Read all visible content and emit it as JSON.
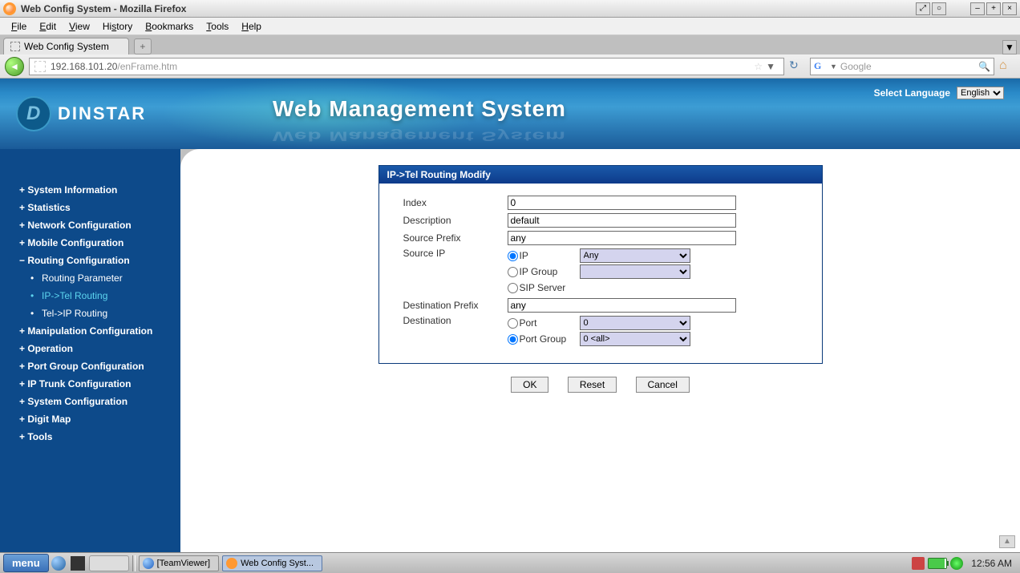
{
  "window": {
    "title": "Web Config System - Mozilla Firefox",
    "btn_min": "–",
    "btn_max": "+",
    "btn_close": "×"
  },
  "menubar": [
    "File",
    "Edit",
    "View",
    "History",
    "Bookmarks",
    "Tools",
    "Help"
  ],
  "tab": {
    "title": "Web Config System"
  },
  "url": {
    "host": "192.168.101.20",
    "path": "/enFrame.htm"
  },
  "search": {
    "placeholder": "Google"
  },
  "banner": {
    "brand": "DINSTAR",
    "title": "Web Management System",
    "lang_label": "Select Language",
    "lang_value": "English"
  },
  "sidebar": {
    "items": [
      {
        "label": "System Information",
        "type": "top"
      },
      {
        "label": "Statistics",
        "type": "top"
      },
      {
        "label": "Network Configuration",
        "type": "top"
      },
      {
        "label": "Mobile Configuration",
        "type": "top"
      },
      {
        "label": "Routing Configuration",
        "type": "top-expanded"
      },
      {
        "label": "Routing Parameter",
        "type": "sub"
      },
      {
        "label": "IP->Tel Routing",
        "type": "sub-active"
      },
      {
        "label": "Tel->IP Routing",
        "type": "sub"
      },
      {
        "label": "Manipulation Configuration",
        "type": "top"
      },
      {
        "label": "Operation",
        "type": "top"
      },
      {
        "label": "Port Group Configuration",
        "type": "top"
      },
      {
        "label": "IP Trunk Configuration",
        "type": "top"
      },
      {
        "label": "System Configuration",
        "type": "top"
      },
      {
        "label": "Digit Map",
        "type": "top"
      },
      {
        "label": "Tools",
        "type": "top"
      }
    ]
  },
  "panel": {
    "title": "IP->Tel Routing Modify",
    "labels": {
      "index": "Index",
      "description": "Description",
      "source_prefix": "Source Prefix",
      "source_ip": "Source IP",
      "ip": "IP",
      "ip_group": "IP Group",
      "sip_server": "SIP Server",
      "dest_prefix": "Destination Prefix",
      "destination": "Destination",
      "port": "Port",
      "port_group": "Port Group"
    },
    "values": {
      "index": "0",
      "description": "default",
      "source_prefix": "any",
      "ip_select": "Any",
      "ip_group_select": "",
      "dest_prefix": "any",
      "port_select": "0",
      "port_group_select": "0 <all>"
    },
    "buttons": {
      "ok": "OK",
      "reset": "Reset",
      "cancel": "Cancel"
    }
  },
  "taskbar": {
    "menu": "menu",
    "tasks": [
      {
        "label": "[TeamViewer]",
        "active": false
      },
      {
        "label": "Web Config Syst...",
        "active": true
      }
    ],
    "clock": "12:56 AM"
  }
}
